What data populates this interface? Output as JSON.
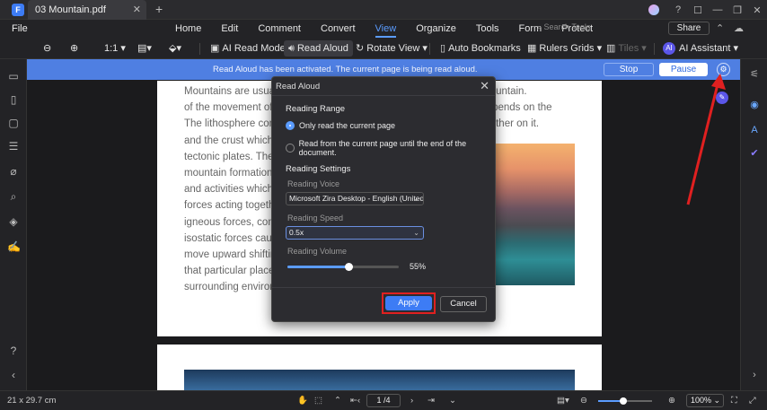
{
  "titlebar": {
    "logo": "F",
    "tab_title": "03 Mountain.pdf",
    "tab_close": "✕",
    "new_tab": "+",
    "icons": [
      "avatar",
      "help-icon",
      "notification-icon",
      "minimize-icon",
      "restore-icon",
      "close-icon"
    ]
  },
  "menubar": {
    "file": "File",
    "items": [
      "Home",
      "Edit",
      "Comment",
      "Convert",
      "View",
      "Organize",
      "Tools",
      "Form",
      "Protect"
    ],
    "active": "View",
    "search_placeholder": "Search Tools",
    "share": "Share"
  },
  "toolbar": {
    "zoom_ratio": "1:1",
    "ai_read_mode": "AI Read Mode",
    "read_aloud": "Read Aloud",
    "rotate_view": "Rotate View",
    "auto_bookmarks": "Auto Bookmarks",
    "rulers_grids": "Rulers Grids",
    "tiles": "Tiles",
    "ai_assistant": "AI Assistant",
    "ai_badge": "AI"
  },
  "banner": {
    "message": "Read Aloud has been activated. The current page is being read aloud.",
    "stop": "Stop",
    "pause": "Pause"
  },
  "document": {
    "lines": [
      "Mountains are usually formed by tectonic forces. referred to as a mountain.",
      "of the movement of the lithosphere. The formation of a mountain depends on the",
      "The lithosphere consists of plates which can move relative to each other on it.",
      "and the crust which are",
      "tectonic plates. The g",
      "mountain formation in",
      "and activities which ha",
      "forces acting togethe",
      "igneous forces, comp",
      "isostatic forces cause",
      "move upward shifting",
      "that particular place t",
      "surrounding    environ"
    ]
  },
  "dialog": {
    "title": "Read Aloud",
    "close": "✕",
    "reading_range": "Reading Range",
    "option_current": "Only read the current page",
    "option_until_end": "Read from the current page until the end of the document.",
    "selected_option": "current",
    "reading_settings": "Reading Settings",
    "voice_label": "Reading Voice",
    "voice_value": "Microsoft Zira Desktop - English (United S",
    "speed_label": "Reading Speed",
    "speed_value": "0.5x",
    "volume_label": "Reading Volume",
    "volume_value": "55%",
    "volume_fraction": 0.55,
    "apply": "Apply",
    "cancel": "Cancel"
  },
  "statusbar": {
    "page_size": "21 x 29.7 cm",
    "page_indicator": "1 /4",
    "zoom": "100%",
    "zoom_fraction": 0.47
  },
  "colors": {
    "accent": "#3d7cf5",
    "banner": "#4f7fe2",
    "highlight": "#e02020"
  }
}
